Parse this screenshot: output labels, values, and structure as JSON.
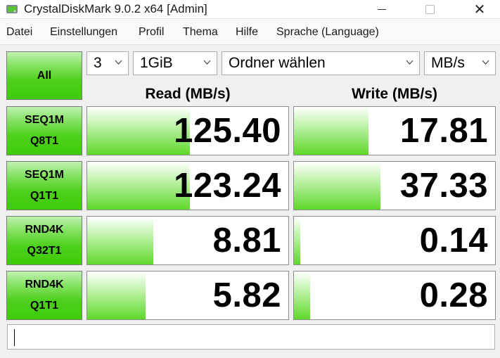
{
  "window": {
    "title": "CrystalDiskMark 9.0.2 x64 [Admin]",
    "controls": {
      "minimize": "",
      "maximize": "",
      "close": "✕"
    }
  },
  "menu": [
    "Datei",
    "Einstellungen",
    "Profil",
    "Thema",
    "Hilfe",
    "Sprache (Language)"
  ],
  "controls": {
    "all_label": "All",
    "count": "3",
    "size": "1GiB",
    "drive": "Ordner wählen",
    "unit": "MB/s"
  },
  "headers": {
    "read": "Read (MB/s)",
    "write": "Write (MB/s)"
  },
  "tests": [
    {
      "line1": "SEQ1M",
      "line2": "Q8T1",
      "read": "125.40",
      "write": "17.81",
      "read_fill": 0.51,
      "write_fill": 0.37
    },
    {
      "line1": "SEQ1M",
      "line2": "Q1T1",
      "read": "123.24",
      "write": "37.33",
      "read_fill": 0.51,
      "write_fill": 0.43
    },
    {
      "line1": "RND4K",
      "line2": "Q32T1",
      "read": "8.81",
      "write": "0.14",
      "read_fill": 0.33,
      "write_fill": 0.03
    },
    {
      "line1": "RND4K",
      "line2": "Q1T1",
      "read": "5.82",
      "write": "0.28",
      "read_fill": 0.29,
      "write_fill": 0.08
    }
  ],
  "comment": "",
  "colors": {
    "accent_green": "#3ecb09",
    "background": "#f0f0f0"
  }
}
